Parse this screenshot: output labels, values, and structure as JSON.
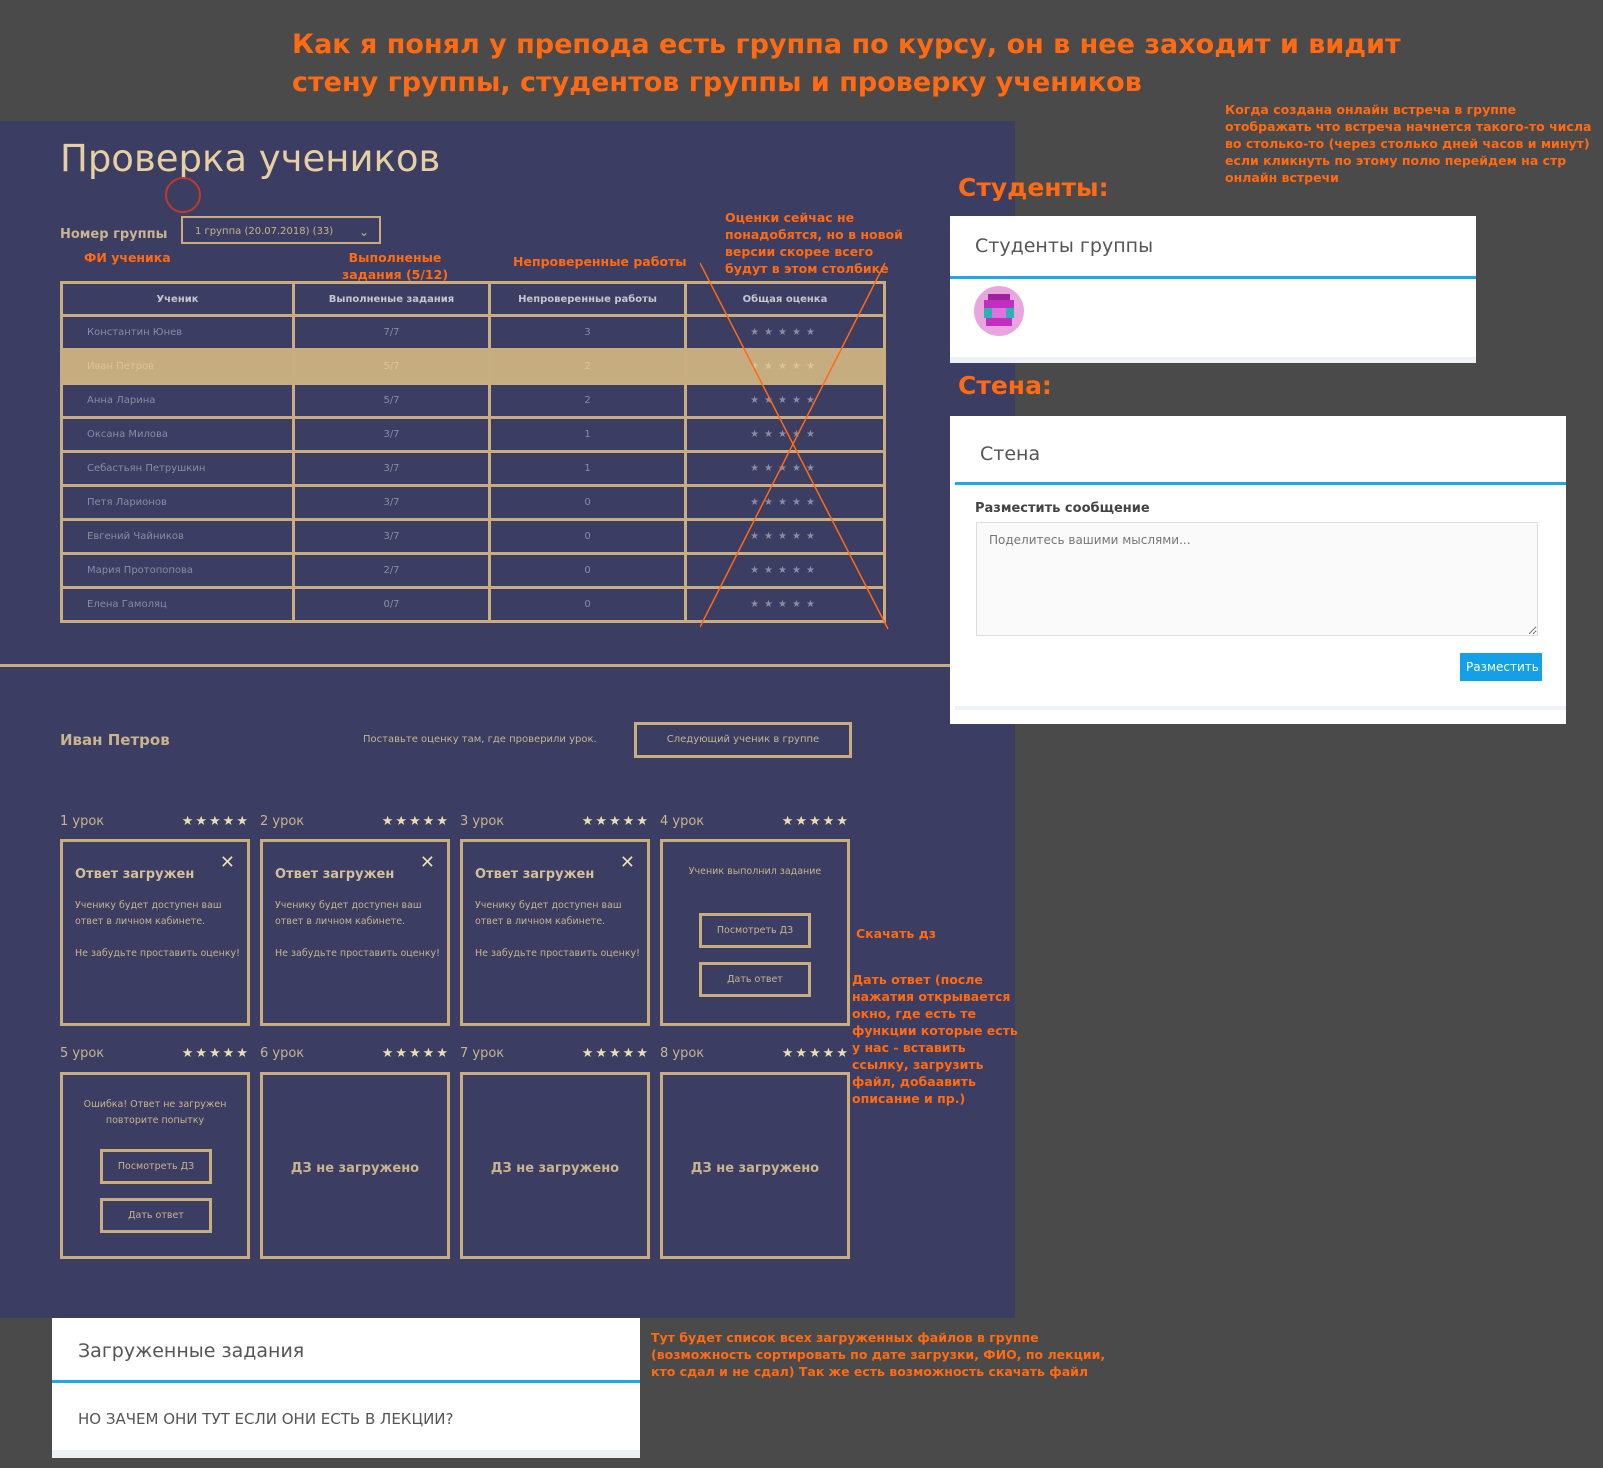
{
  "headline": "Как я понял у препода есть группа по курсу, он в нее заходит и видит стену группы, студентов группы и проверку учеников",
  "note_meeting": "Когда создана онлайн встреча в группе отображать что встреча начнется такого-то числа во столько-то (через столько дней часов и минут) если кликнуть по этому полю перейдем на стр онлайн встречи",
  "board": {
    "title": "Проверка учеников",
    "group_label": "Номер группы",
    "group_value": "1 группа (20.07.2018) (33)",
    "annotations": {
      "fio": "ФИ ученика",
      "done": "Выполненые задания (5/12)",
      "unchecked": "Непроверенные работы",
      "grades": "Оценки сейчас не понадобятся, но в новой версии скорее всего будут в этом столбике"
    },
    "columns": [
      "Ученик",
      "Выполненые задания",
      "Непроверенные работы",
      "Общая оценка"
    ],
    "rows": [
      {
        "name": "Константин Юнев",
        "done": "7/7",
        "unchecked": "3",
        "rating": "★★★★★"
      },
      {
        "name": "Иван Петров",
        "done": "5/7",
        "unchecked": "2",
        "rating": "★★★★★"
      },
      {
        "name": "Анна Ларина",
        "done": "5/7",
        "unchecked": "2",
        "rating": "★★★★★"
      },
      {
        "name": "Оксана Милова",
        "done": "3/7",
        "unchecked": "1",
        "rating": "★★★★★"
      },
      {
        "name": "Себастьян Петрушкин",
        "done": "3/7",
        "unchecked": "1",
        "rating": "★★★★★"
      },
      {
        "name": "Петя Ларионов",
        "done": "3/7",
        "unchecked": "0",
        "rating": "★★★★★"
      },
      {
        "name": "Евгений Чайников",
        "done": "3/7",
        "unchecked": "0",
        "rating": "★★★★★"
      },
      {
        "name": "Мария Протопопова",
        "done": "2/7",
        "unchecked": "0",
        "rating": "★★★★★"
      },
      {
        "name": "Елена Гамоляц",
        "done": "0/7",
        "unchecked": "0",
        "rating": "★★★★★"
      }
    ],
    "highlighted_row": 1,
    "student": "Иван Петров",
    "hint": "Поставьте оценку там, где проверили урок.",
    "next_button": "Следующий ученик в группе",
    "lesson_stars": "★★★★★",
    "close_glyph": "✕",
    "lessons": [
      {
        "label": "1 урок",
        "title": "Ответ загружен",
        "body": "Ученику будет доступен ваш ответ в личном кабинете.",
        "body2": "Не забудьте проставить оценку!"
      },
      {
        "label": "2 урок",
        "title": "Ответ загружен",
        "body": "Ученику будет доступен ваш ответ в личном кабинете.",
        "body2": "Не забудьте проставить оценку!"
      },
      {
        "label": "3 урок",
        "title": "Ответ загружен",
        "body": "Ученику будет доступен ваш ответ в личном кабинете.",
        "body2": "Не забудьте проставить оценку!"
      },
      {
        "label": "4 урок",
        "message": "Ученик выполнил задание",
        "btn1": "Посмотреть ДЗ",
        "btn2": "Дать ответ"
      },
      {
        "label": "5 урок",
        "message": "Ошибка! Ответ не загружен повторите попытку",
        "btn1": "Посмотреть ДЗ",
        "btn2": "Дать ответ"
      },
      {
        "label": "6 урок",
        "empty": "ДЗ не загружено"
      },
      {
        "label": "7 урок",
        "empty": "ДЗ не загружено"
      },
      {
        "label": "8 урок",
        "empty": "ДЗ не загружено"
      }
    ]
  },
  "students_panel": {
    "heading": "Студенты:",
    "title": "Студенты группы"
  },
  "wall_panel": {
    "heading": "Стена:",
    "title": "Стена",
    "subtitle": "Разместить сообщение",
    "placeholder": "Поделитесь вашими мыслями...",
    "button": "Разместить"
  },
  "note_download": "Скачать дз",
  "note_answer": "Дать ответ (после нажатия открывается окно, где есть  те функции которые есть у нас - вставить ссылку, загрузить файл, добаавить описание и пр.)",
  "files_panel": {
    "title": "Загруженные задания",
    "body": "НО ЗАЧЕМ ОНИ ТУТ ЕСЛИ ОНИ ЕСТЬ В ЛЕКЦИИ?"
  },
  "note_files": "Тут будет список всех загруженных файлов в группе (возможность сортировать по дате загрузки, ФИО, по лекции, кто сдал и не сдал) Так же есть возможность скачать файл",
  "colors": {
    "background": "#4a4a4a",
    "board": "#3b3d62",
    "gold": "#c9ad7e",
    "accent_orange": "#ff6a13",
    "blue": "#1fa7e8"
  }
}
